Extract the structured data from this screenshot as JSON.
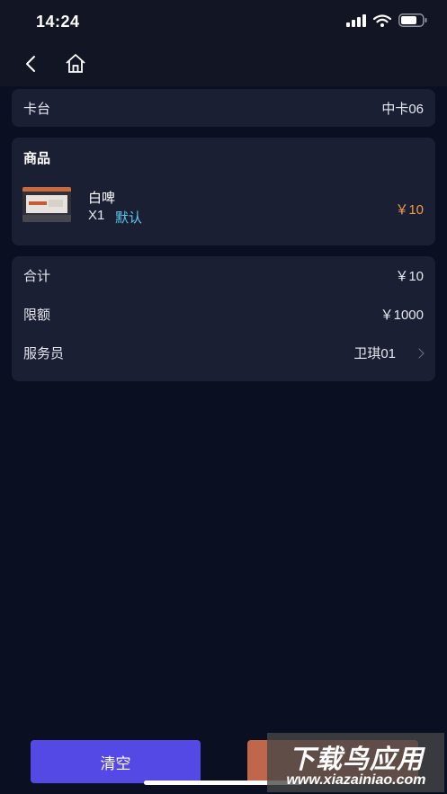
{
  "status": {
    "time": "14:24"
  },
  "table_card": {
    "label": "卡台",
    "value": "中卡06"
  },
  "goods_card": {
    "title": "商品",
    "items": [
      {
        "name": "白啤",
        "qty": "X1",
        "spec": "默认",
        "price": "￥10"
      }
    ]
  },
  "summary_card": {
    "total_label": "合计",
    "total_value": "￥10",
    "limit_label": "限额",
    "limit_value": "￥1000",
    "waiter_label": "服务员",
    "waiter_value": "卫琪01"
  },
  "buttons": {
    "clear": "清空"
  },
  "watermark": {
    "title": "下载鸟应用",
    "url": "www.xiazainiao.com"
  },
  "colors": {
    "background": "#0b0f22",
    "card": "#1b1f33",
    "price": "#ee9b4a",
    "spec": "#5ec8ee",
    "clear_button": "#5549e6",
    "submit_button": "#c0664a"
  },
  "icons": [
    "signal-icon",
    "wifi-icon",
    "battery-icon",
    "back-arrow-icon",
    "home-icon",
    "chevron-right-icon"
  ]
}
